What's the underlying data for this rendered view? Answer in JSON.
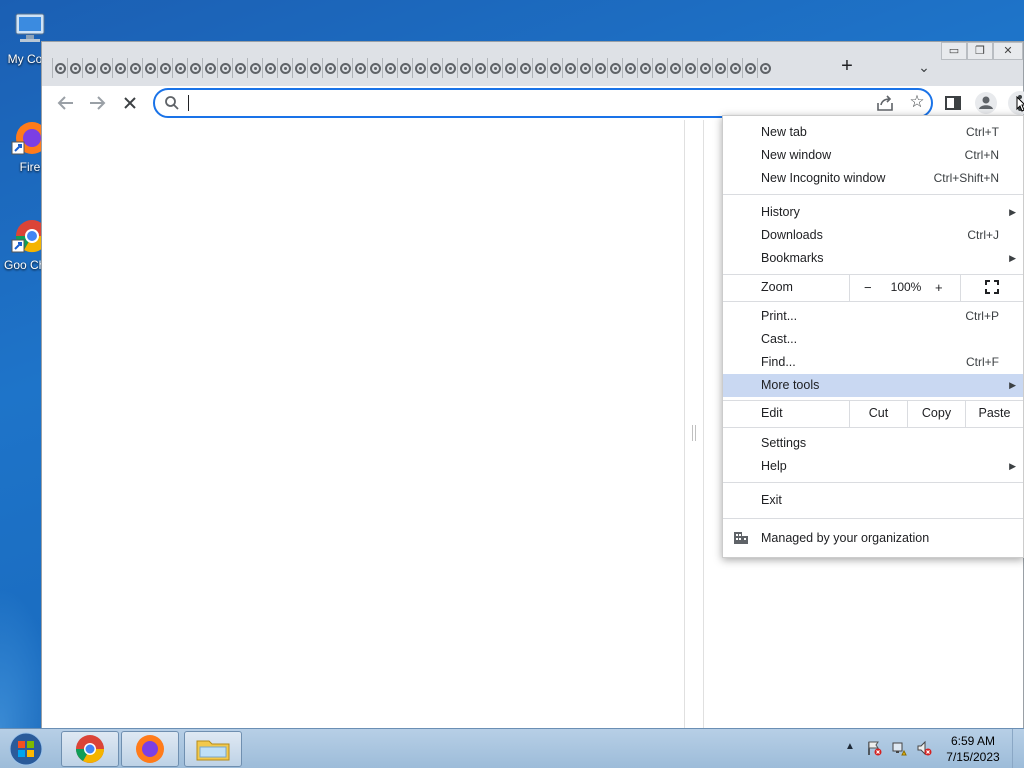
{
  "desktop": {
    "icons": [
      {
        "name": "my-computer",
        "label": "My Com"
      },
      {
        "name": "firefox",
        "label": "Fire"
      },
      {
        "name": "chrome",
        "label": "Goo Chro"
      }
    ]
  },
  "browser": {
    "tab_count": 48,
    "new_tab_symbol": "+",
    "tab_search_symbol": "⌄",
    "caption": {
      "minimize": "▭",
      "restore": "❐",
      "close": "✕"
    },
    "omnibox": {
      "value": "",
      "placeholder": ""
    }
  },
  "menu": {
    "items": [
      {
        "label": "New tab",
        "shortcut": "Ctrl+T"
      },
      {
        "label": "New window",
        "shortcut": "Ctrl+N"
      },
      {
        "label": "New Incognito window",
        "shortcut": "Ctrl+Shift+N"
      },
      {
        "label": "History",
        "shortcut": ""
      },
      {
        "label": "Downloads",
        "shortcut": "Ctrl+J"
      },
      {
        "label": "Bookmarks",
        "shortcut": ""
      },
      {
        "label": "Print...",
        "shortcut": "Ctrl+P"
      },
      {
        "label": "Cast...",
        "shortcut": ""
      },
      {
        "label": "Find...",
        "shortcut": "Ctrl+F"
      },
      {
        "label": "More tools",
        "shortcut": ""
      },
      {
        "label": "Settings",
        "shortcut": ""
      },
      {
        "label": "Help",
        "shortcut": ""
      },
      {
        "label": "Exit",
        "shortcut": ""
      }
    ],
    "zoom": {
      "label": "Zoom",
      "minus": "−",
      "value": "100%",
      "plus": "+"
    },
    "edit": {
      "label": "Edit",
      "cut": "Cut",
      "copy": "Copy",
      "paste": "Paste"
    },
    "managed": "Managed by your organization",
    "highlight_color": "#c9d8f2"
  },
  "taskbar": {
    "clock": {
      "time": "6:59 AM",
      "date": "7/15/2023"
    },
    "tray_arrow": "▲"
  }
}
